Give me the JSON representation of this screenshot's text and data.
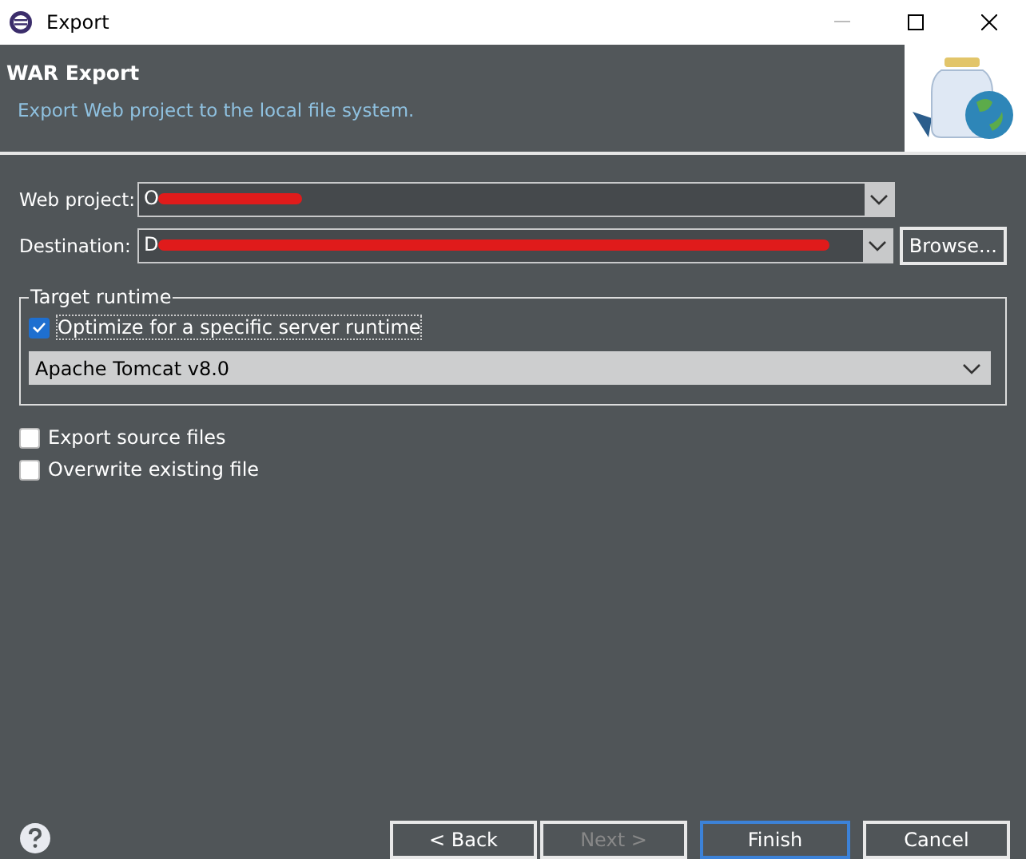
{
  "window": {
    "title": "Export"
  },
  "header": {
    "title": "WAR Export",
    "description": "Export Web project to the local file system."
  },
  "fields": [
    {
      "label": "Web project:",
      "value": "O",
      "redacted": true
    },
    {
      "label": "Destination:",
      "value": "D",
      "redacted": true,
      "button": "Browse..."
    }
  ],
  "target_runtime": {
    "legend": "Target runtime",
    "optimize": {
      "label": "Optimize for a specific server runtime",
      "checked": true
    },
    "runtime": "Apache Tomcat v8.0"
  },
  "options": [
    {
      "label": "Export source files",
      "checked": false
    },
    {
      "label": "Overwrite existing file",
      "checked": false
    }
  ],
  "buttons": [
    {
      "label": "< Back",
      "disabled": false,
      "default": false
    },
    {
      "label": "Next >",
      "disabled": true,
      "default": false
    },
    {
      "label": "Finish",
      "disabled": false,
      "default": true
    },
    {
      "label": "Cancel",
      "disabled": false,
      "default": false
    }
  ]
}
